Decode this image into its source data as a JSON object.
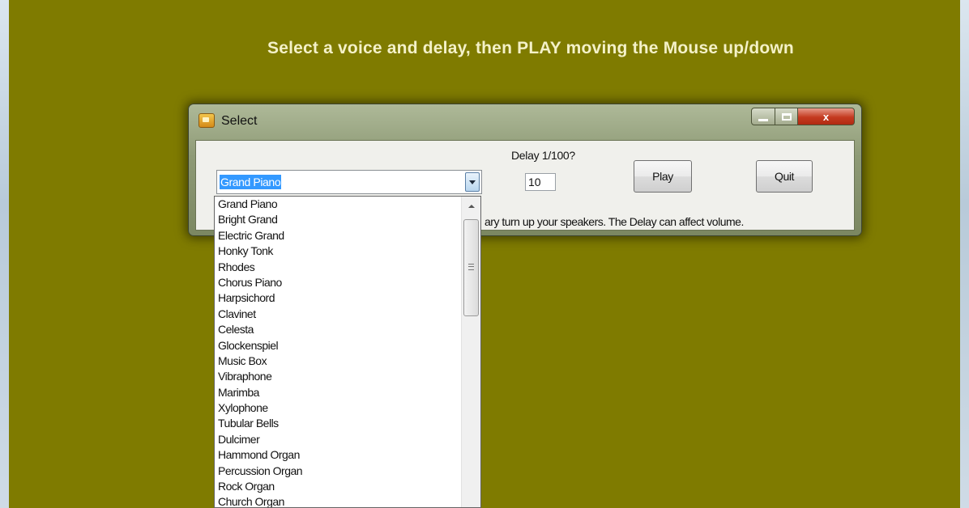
{
  "instruction": "Select a voice and delay, then PLAY moving the Mouse up/down",
  "window": {
    "title": "Select",
    "icon": "app-icon",
    "caption_buttons": [
      "minimize-icon",
      "maximize-icon",
      "close-icon"
    ],
    "close_glyph": "x"
  },
  "voice_select": {
    "selected": "Grand Piano",
    "options": [
      "Grand Piano",
      "Bright Grand",
      "Electric Grand",
      "Honky Tonk",
      "Rhodes",
      "Chorus Piano",
      "Harpsichord",
      "Clavinet",
      "Celesta",
      "Glockenspiel",
      "Music Box",
      "Vibraphone",
      "Marimba",
      "Xylophone",
      "Tubular Bells",
      "Dulcimer",
      "Hammond Organ",
      "Percussion Organ",
      "Rock Organ",
      "Church Organ"
    ]
  },
  "delay": {
    "label": "Delay 1/100?",
    "value": "10"
  },
  "buttons": {
    "play": "Play",
    "quit": "Quit"
  },
  "hint_text": "ary turn up your speakers. The Delay can affect volume.",
  "colors": {
    "background": "#7f7b00",
    "instruction_text": "#f4f1c8",
    "selection": "#3399ff",
    "close_button": "#c43a20"
  }
}
